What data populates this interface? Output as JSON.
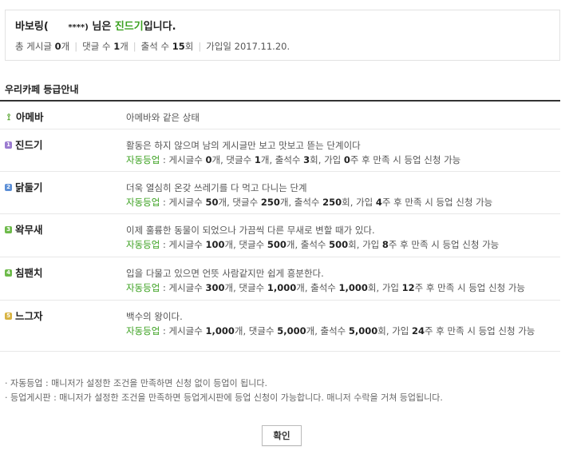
{
  "profile": {
    "nickname": "바보링(",
    "masked_id": "****)",
    "suffix_pre": " 님은 ",
    "grade": "진드기",
    "suffix_post": "입니다.",
    "posts_label": "총 게시글",
    "posts_value": "0",
    "posts_unit": "개",
    "comments_label": "댓글 수",
    "comments_value": "1",
    "comments_unit": "개",
    "attendance_label": "출석 수",
    "attendance_value": "15",
    "attendance_unit": "회",
    "joined_label": "가입일",
    "joined_value": "2017.11.20."
  },
  "section_title": "우리카페 등급안내",
  "grades": [
    {
      "icon": "sprout-icon",
      "name": "아메바",
      "desc": "아메바와 같은 상태",
      "auto": null
    },
    {
      "icon": "grade-1-icon",
      "name": "진드기",
      "desc": "활동은 하지 않으며 남의 게시글만 보고 맛보고 뜯는 단계이다",
      "auto": {
        "label": "자동등업",
        "posts": "0",
        "comments": "1",
        "attendance": "3",
        "weeks": "0"
      }
    },
    {
      "icon": "grade-2-icon",
      "name": "닭둘기",
      "desc": "더욱 열심히 온갖 쓰레기를 다 먹고 다니는 단계",
      "auto": {
        "label": "자동등업",
        "posts": "50",
        "comments": "250",
        "attendance": "250",
        "weeks": "4"
      }
    },
    {
      "icon": "grade-3-icon",
      "name": "왁무새",
      "desc": "이제 훌륭한 동물이 되었으나 가끔씩 다른 무새로 변할 때가 있다.",
      "auto": {
        "label": "자동등업",
        "posts": "100",
        "comments": "500",
        "attendance": "500",
        "weeks": "8"
      }
    },
    {
      "icon": "grade-4-icon",
      "name": "침팬치",
      "desc": "입을 다물고 있으면 언뜻 사람같지만 쉽게 흥분한다.",
      "auto": {
        "label": "자동등업",
        "posts": "300",
        "comments": "1,000",
        "attendance": "1,000",
        "weeks": "12"
      }
    },
    {
      "icon": "grade-5-icon",
      "name": "느그자",
      "desc": "백수의 왕이다.",
      "auto": {
        "label": "자동등업",
        "posts": "1,000",
        "comments": "5,000",
        "attendance": "5,000",
        "weeks": "24"
      }
    }
  ],
  "auto_text": {
    "posts_label": "게시글수",
    "comments_label": "댓글수",
    "attendance_label": "출석수",
    "join_label": "가입",
    "count_unit": "개",
    "times_unit": "회",
    "weeks_unit": "주",
    "tail": "후 만족 시 등업 신청 가능"
  },
  "notes": [
    "· 자동등업 : 매니저가 설정한 조건을 만족하면 신청 없이 등업이 됩니다.",
    "· 등업게시판 : 매니저가 설정한 조건을 만족하면 등업게시판에 등업 신청이 가능합니다. 매니저 수락을 거쳐 등업됩니다."
  ],
  "confirm_label": "확인",
  "colors": {
    "accent_green": "#3ba120",
    "border": "#e2e2e2",
    "divider": "#333333"
  }
}
